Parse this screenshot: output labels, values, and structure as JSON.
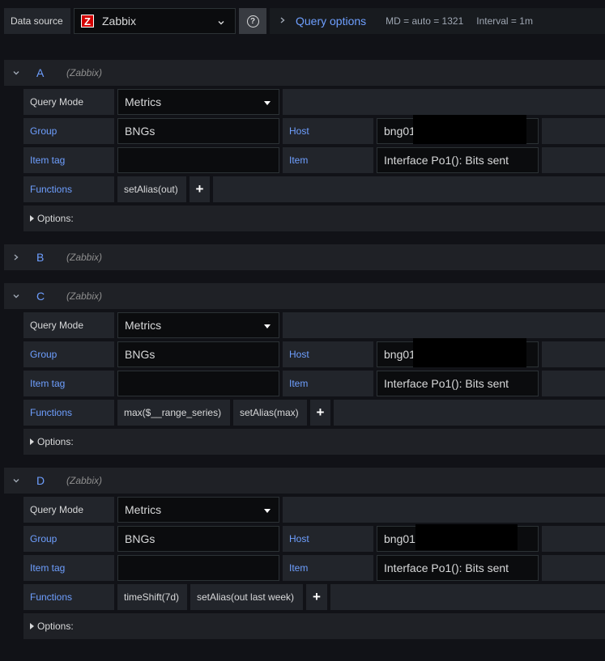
{
  "topbar": {
    "datasource_label": "Data source",
    "datasource_value": "Zabbix",
    "zabbix_logo_letter": "Z",
    "query_options_label": "Query options",
    "md_text": "MD = auto = 1321",
    "interval_text": "Interval = 1m",
    "help_glyph": "?"
  },
  "labels": {
    "query_mode": "Query Mode",
    "group": "Group",
    "host": "Host",
    "item_tag": "Item tag",
    "item": "Item",
    "functions": "Functions",
    "options": "Options:"
  },
  "colors": {
    "background": "#111217",
    "panel": "#22252b",
    "input_bg": "#0b0c0e",
    "accent_blue": "#6e9fff",
    "zabbix_red": "#d40000"
  },
  "queries": [
    {
      "ref": "A",
      "ds": "(Zabbix)",
      "expanded": true,
      "mode": "Metrics",
      "group": "BNGs",
      "host": "bng01",
      "item_tag": "",
      "item": "Interface Po1(): Bits sent",
      "functions": [
        "setAlias(out)"
      ],
      "plus": "+"
    },
    {
      "ref": "B",
      "ds": "(Zabbix)",
      "expanded": false
    },
    {
      "ref": "C",
      "ds": "(Zabbix)",
      "expanded": true,
      "mode": "Metrics",
      "group": "BNGs",
      "host": "bng01",
      "item_tag": "",
      "item": "Interface Po1(): Bits sent",
      "functions": [
        "max($__range_series)",
        "setAlias(max)"
      ],
      "plus": "+"
    },
    {
      "ref": "D",
      "ds": "(Zabbix)",
      "expanded": true,
      "mode": "Metrics",
      "group": "BNGs",
      "host": "bng01",
      "item_tag": "",
      "item": "Interface Po1(): Bits sent",
      "functions": [
        "timeShift(7d)",
        "setAlias(out last week)"
      ],
      "plus": "+"
    }
  ]
}
